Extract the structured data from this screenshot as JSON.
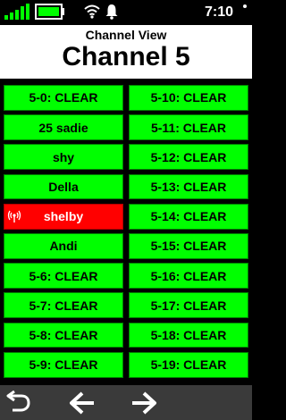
{
  "status_bar": {
    "time": "7:10",
    "icons": [
      "signal-icon",
      "battery-icon",
      "wifi-icon",
      "bell-icon"
    ]
  },
  "header": {
    "subtitle": "Channel View",
    "title": "Channel 5"
  },
  "colors": {
    "clear": "#00ff00",
    "active": "#ff0000",
    "header_bg": "#ffffff",
    "nav_bg": "#3a3a3a"
  },
  "channels": {
    "left": [
      {
        "label": "5-0: CLEAR",
        "active": false
      },
      {
        "label": "25 sadie",
        "active": false
      },
      {
        "label": "shy",
        "active": false
      },
      {
        "label": "Della",
        "active": false
      },
      {
        "label": "shelby",
        "active": true,
        "icon": "transmit-icon"
      },
      {
        "label": "Andi",
        "active": false
      },
      {
        "label": "5-6: CLEAR",
        "active": false
      },
      {
        "label": "5-7: CLEAR",
        "active": false
      },
      {
        "label": "5-8: CLEAR",
        "active": false
      },
      {
        "label": "5-9: CLEAR",
        "active": false
      }
    ],
    "right": [
      {
        "label": "5-10: CLEAR",
        "active": false
      },
      {
        "label": "5-11: CLEAR",
        "active": false
      },
      {
        "label": "5-12: CLEAR",
        "active": false
      },
      {
        "label": "5-13: CLEAR",
        "active": false
      },
      {
        "label": "5-14: CLEAR",
        "active": false
      },
      {
        "label": "5-15: CLEAR",
        "active": false
      },
      {
        "label": "5-16: CLEAR",
        "active": false
      },
      {
        "label": "5-17: CLEAR",
        "active": false
      },
      {
        "label": "5-18: CLEAR",
        "active": false
      },
      {
        "label": "5-19: CLEAR",
        "active": false
      }
    ]
  },
  "nav": {
    "buttons": [
      "back-icon",
      "arrow-left-icon",
      "arrow-right-icon"
    ]
  }
}
